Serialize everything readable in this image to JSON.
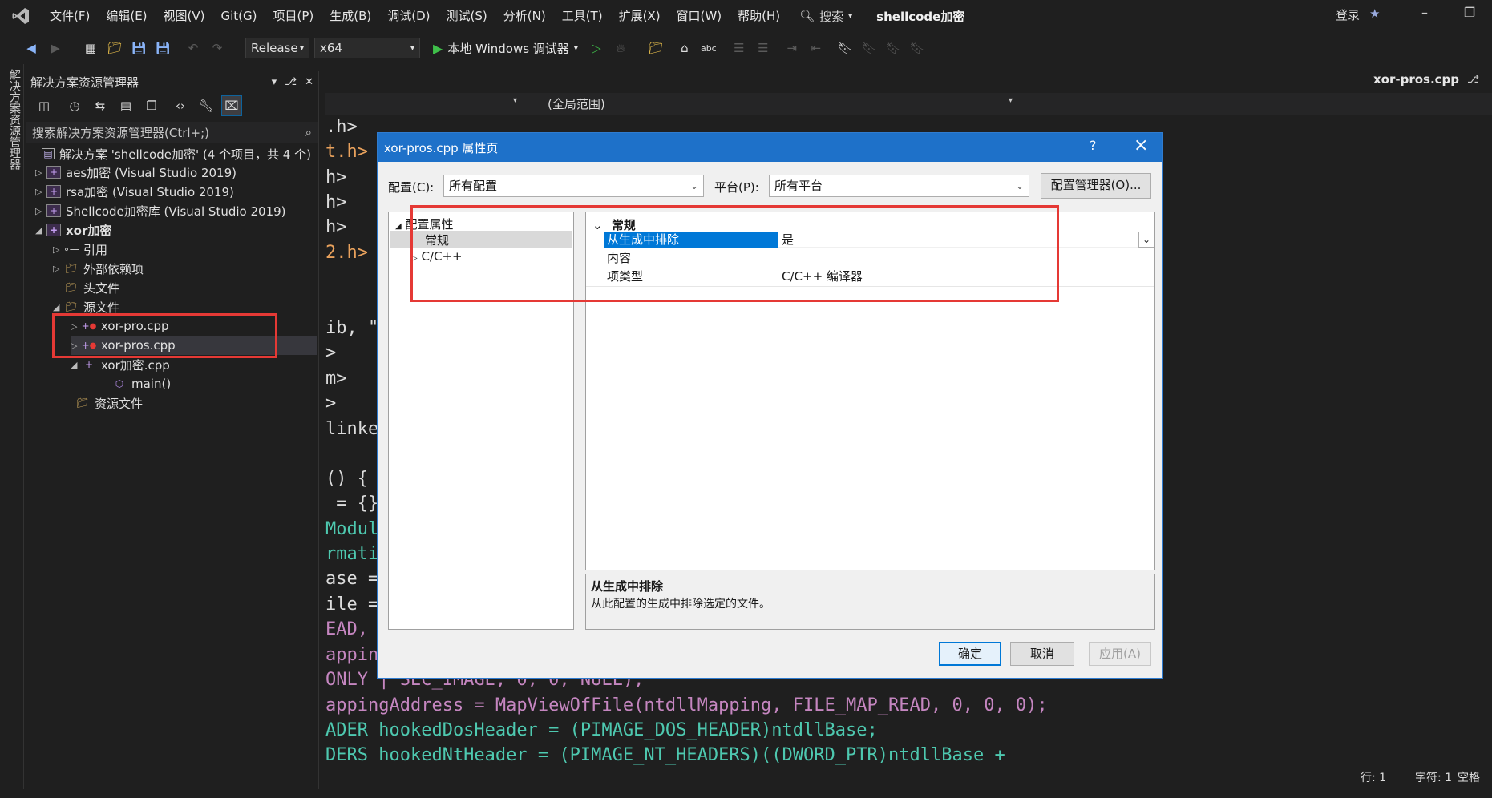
{
  "menubar": {
    "items": [
      "文件(F)",
      "编辑(E)",
      "视图(V)",
      "Git(G)",
      "项目(P)",
      "生成(B)",
      "调试(D)",
      "测试(S)",
      "分析(N)",
      "工具(T)",
      "扩展(X)",
      "窗口(W)",
      "帮助(H)"
    ],
    "search_label": "搜索",
    "solution_name": "shellcode加密",
    "login": "登录"
  },
  "toolbar": {
    "config": "Release",
    "platform": "x64",
    "run_label": "本地 Windows 调试器"
  },
  "left_strip_label": "解决方案资源管理器",
  "solution_explorer": {
    "title": "解决方案资源管理器",
    "search_placeholder": "搜索解决方案资源管理器(Ctrl+;)",
    "tree": {
      "solution": "解决方案 'shellcode加密' (4 个项目，共 4 个)",
      "aes": "aes加密 (Visual Studio 2019)",
      "rsa": "rsa加密 (Visual Studio 2019)",
      "lib": "Shellcode加密库 (Visual Studio 2019)",
      "xor": "xor加密",
      "refs": "引用",
      "extdeps": "外部依赖项",
      "headers": "头文件",
      "sources": "源文件",
      "file1": "xor-pro.cpp",
      "file2": "xor-pros.cpp",
      "file3": "xor加密.cpp",
      "main": "main()",
      "resources": "资源文件"
    }
  },
  "editor": {
    "tab": "xor-pros.cpp",
    "scope": "(全局范围)",
    "lines": [
      ".h>",
      "t.h>",
      "h>",
      "h>",
      "h>",
      "2.h>",
      "ib, \"",
      ">",
      "m>",
      ">",
      "linke",
      "() {",
      " = {}",
      "Modul",
      "rmati",
      "ase =",
      "ile =",
      "EAD,",
      "appin",
      "ONLY | SEC_IMAGE, 0, 0, NULL);",
      "appingAddress = MapViewOfFile(ntdllMapping, FILE_MAP_READ, 0, 0, 0);",
      "ADER hookedDosHeader = (PIMAGE_DOS_HEADER)ntdllBase;",
      "DERS hookedNtHeader = (PIMAGE_NT_HEADERS)((DWORD_PTR)ntdllBase +"
    ]
  },
  "status": {
    "line": "行: 1",
    "col": "字符: 1",
    "spaces": "空格"
  },
  "dialog": {
    "title": "xor-pros.cpp 属性页",
    "help": "?",
    "config_label": "配置(C):",
    "config_value": "所有配置",
    "platform_label": "平台(P):",
    "platform_value": "所有平台",
    "config_manager": "配置管理器(O)...",
    "tree_root": "配置属性",
    "tree_general": "常规",
    "tree_cpp": "C/C++",
    "section": "常规",
    "props": [
      {
        "name": "从生成中排除",
        "value": "是"
      },
      {
        "name": "内容",
        "value": ""
      },
      {
        "name": "项类型",
        "value": "C/C++ 编译器"
      }
    ],
    "desc_title": "从生成中排除",
    "desc_text": "从此配置的生成中排除选定的文件。",
    "ok": "确定",
    "cancel": "取消",
    "apply": "应用(A)"
  }
}
